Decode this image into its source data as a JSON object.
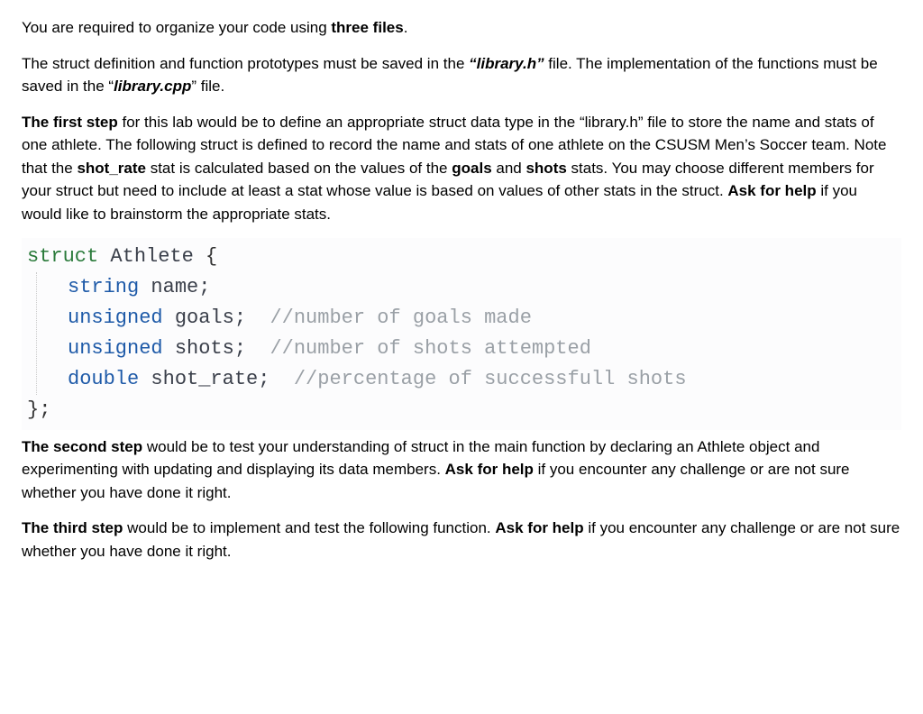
{
  "para1": {
    "t1": "You are required to organize your code using ",
    "b1": "three files",
    "t2": "."
  },
  "para2": {
    "t1": "The struct definition and function prototypes must be saved in the ",
    "b1": "“library.h” ",
    "t2": "file. The implementation of the functions must be saved in the “",
    "b2": "library.cpp",
    "t3": "” file."
  },
  "para3": {
    "b1": "The first step",
    "t1": " for this lab would be to define an appropriate struct data type in the “library.h” file to store the name and stats of one athlete. The following struct is defined to record the name and stats of one athlete on the CSUSM Men’s Soccer team. Note that the ",
    "b2": "shot_rate",
    "t2": " stat is calculated based on the values of the ",
    "b3": "goals",
    "t3": " and ",
    "b4": "shots",
    "t4": " stats. You may choose different members for your struct but need to include at least a stat  whose value is based on values of other stats in the struct. ",
    "b5": "Ask for help",
    "t5": " if you would like to brainstorm the appropriate stats."
  },
  "code": {
    "l1_kw": "struct",
    "l1_name": " Athlete ",
    "l1_brace": "{",
    "l2_type": "string",
    "l2_rest": " name;",
    "l3_type": "unsigned",
    "l3_rest": " goals;  ",
    "l3_comment": "//number of goals made",
    "l4_type": "unsigned",
    "l4_rest": " shots;  ",
    "l4_comment": "//number of shots attempted",
    "l5_type": "double",
    "l5_rest": " shot_rate;  ",
    "l5_comment": "//percentage of successfull shots",
    "l6": "};"
  },
  "para4": {
    "b1": "The second step",
    "t1": " would be to test your understanding of struct in the main function by declaring an Athlete object and experimenting with updating and displaying its data members.  ",
    "b2": "Ask for help",
    "t2": " if you encounter any challenge or are not sure whether you have done it right."
  },
  "para5": {
    "b1": "The third step",
    "t1": " would be to implement and test the following function.  ",
    "b2": "Ask for help",
    "t2": " if you encounter any challenge or are not sure whether you have done it right."
  }
}
